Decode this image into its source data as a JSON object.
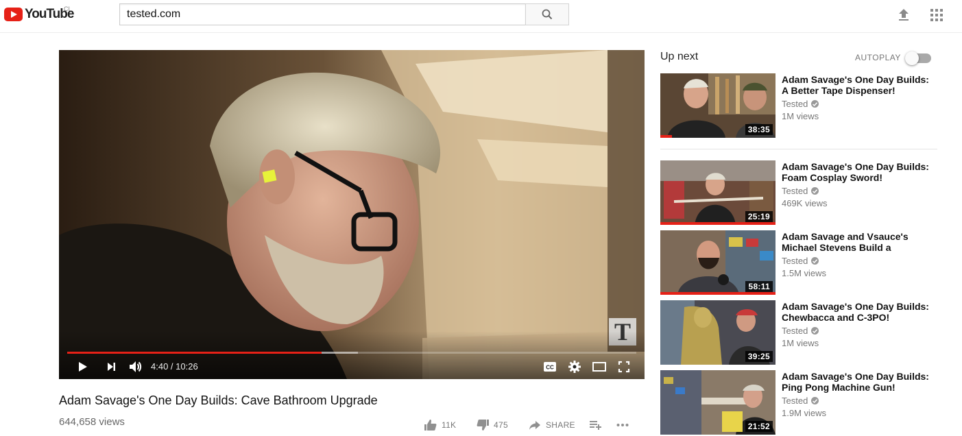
{
  "masthead": {
    "logo_text": "YouTube",
    "country_code": "CL",
    "search_value": "tested.com",
    "search_placeholder": "Search",
    "icons": {
      "search": "search-icon",
      "upload": "upload-icon",
      "apps": "apps-grid-icon"
    }
  },
  "player": {
    "current_time": "4:40",
    "duration": "10:26",
    "time_display": "4:40 / 10:26",
    "played_fraction": 0.447,
    "buffered_fraction": 0.511,
    "watermark_letter": "T",
    "controls": [
      "play-icon",
      "next-icon",
      "volume-icon",
      "captions-icon",
      "settings-icon",
      "theater-mode-icon",
      "fullscreen-icon"
    ]
  },
  "video": {
    "title": "Adam Savage's One Day Builds: Cave Bathroom Upgrade",
    "views": "644,658 views",
    "likes": "11K",
    "dislikes": "475",
    "share_label": "SHARE"
  },
  "sidebar": {
    "up_next_label": "Up next",
    "autoplay_label": "AUTOPLAY",
    "autoplay_on": false,
    "items": [
      {
        "title": "Adam Savage's One Day Builds: A Better Tape Dispenser!",
        "channel": "Tested",
        "views": "1M views",
        "duration": "38:35",
        "watched_fraction": 0.1
      },
      {
        "title": "Adam Savage's One Day Builds: Foam Cosplay Sword!",
        "channel": "Tested",
        "views": "469K views",
        "duration": "25:19",
        "watched_fraction": 1.0
      },
      {
        "title": "Adam Savage and Vsauce's Michael Stevens Build a",
        "channel": "Tested",
        "views": "1.5M views",
        "duration": "58:11",
        "watched_fraction": 1.0
      },
      {
        "title": "Adam Savage's One Day Builds: Chewbacca and C-3PO!",
        "channel": "Tested",
        "views": "1M views",
        "duration": "39:25",
        "watched_fraction": 0
      },
      {
        "title": "Adam Savage's One Day Builds: Ping Pong Machine Gun!",
        "channel": "Tested",
        "views": "1.9M views",
        "duration": "21:52",
        "watched_fraction": 0
      }
    ]
  },
  "colors": {
    "brand_red": "#e62117",
    "text_primary": "#111111",
    "text_secondary": "#777777"
  }
}
